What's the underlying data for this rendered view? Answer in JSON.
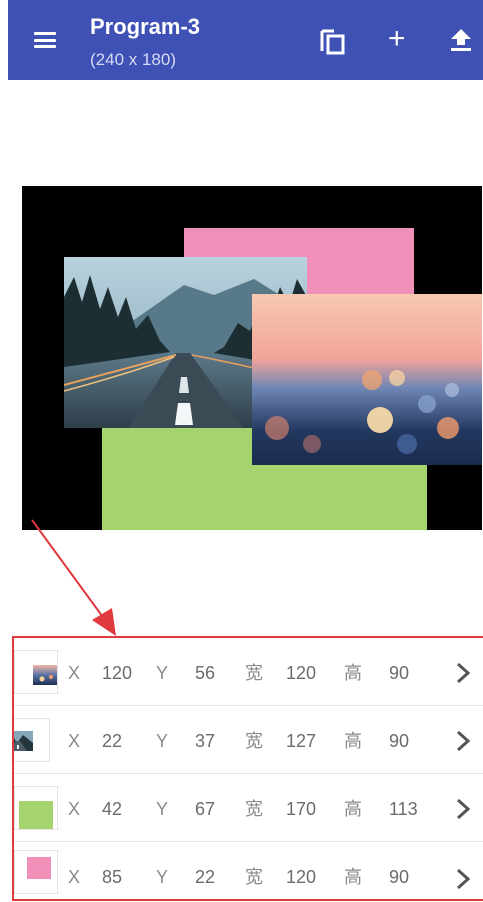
{
  "appbar": {
    "title": "Program-3",
    "subtitle": "(240 x 180)",
    "color": "#3f51b5",
    "icons": [
      "menu-icon",
      "copy-icon",
      "plus-icon",
      "upload-icon"
    ],
    "plus_glyph": "+"
  },
  "canvas": {
    "background": "#000000",
    "layer_colors": {
      "pink": "#f08fb8",
      "green": "#a5d36e"
    }
  },
  "list": {
    "border_color": "#e0393e",
    "rows": [
      {
        "thumb": "bokeh-image",
        "x_label": "X",
        "x": "120",
        "y_label": "Y",
        "y": "56",
        "w_label": "宽",
        "w": "120",
        "h_label": "高",
        "h": "90"
      },
      {
        "thumb": "road-image",
        "x_label": "X",
        "x": "22",
        "y_label": "Y",
        "y": "37",
        "w_label": "宽",
        "w": "127",
        "h_label": "高",
        "h": "90"
      },
      {
        "thumb": "green-color",
        "x_label": "X",
        "x": "42",
        "y_label": "Y",
        "y": "67",
        "w_label": "宽",
        "w": "170",
        "h_label": "高",
        "h": "113"
      },
      {
        "thumb": "pink-color",
        "x_label": "X",
        "x": "85",
        "y_label": "Y",
        "y": "22",
        "w_label": "宽",
        "w": "120",
        "h_label": "高",
        "h": "90"
      }
    ]
  }
}
